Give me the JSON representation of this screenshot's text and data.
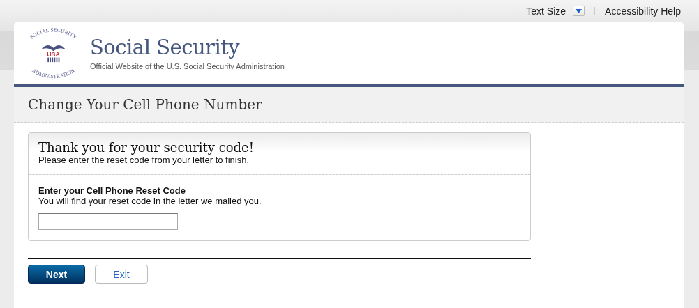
{
  "utility_bar": {
    "text_size_label": "Text Size",
    "accessibility_link": "Accessibility Help"
  },
  "header": {
    "seal": {
      "top": "SOCIAL SECURITY",
      "center": "USA",
      "bottom": "ADMINISTRATION"
    },
    "title": "Social Security",
    "subtitle": "Official Website of the U.S. Social Security Administration"
  },
  "page_title": "Change Your Cell Phone Number",
  "panel": {
    "heading": "Thank you for your security code!",
    "intro": "Please enter the reset code from your letter to finish.",
    "field_label": "Enter your Cell Phone Reset Code",
    "field_hint": "You will find your reset code in the letter we mailed you."
  },
  "buttons": [
    {
      "label": "Next",
      "kind": "primary"
    },
    {
      "label": "Exit",
      "kind": "secondary"
    }
  ]
}
